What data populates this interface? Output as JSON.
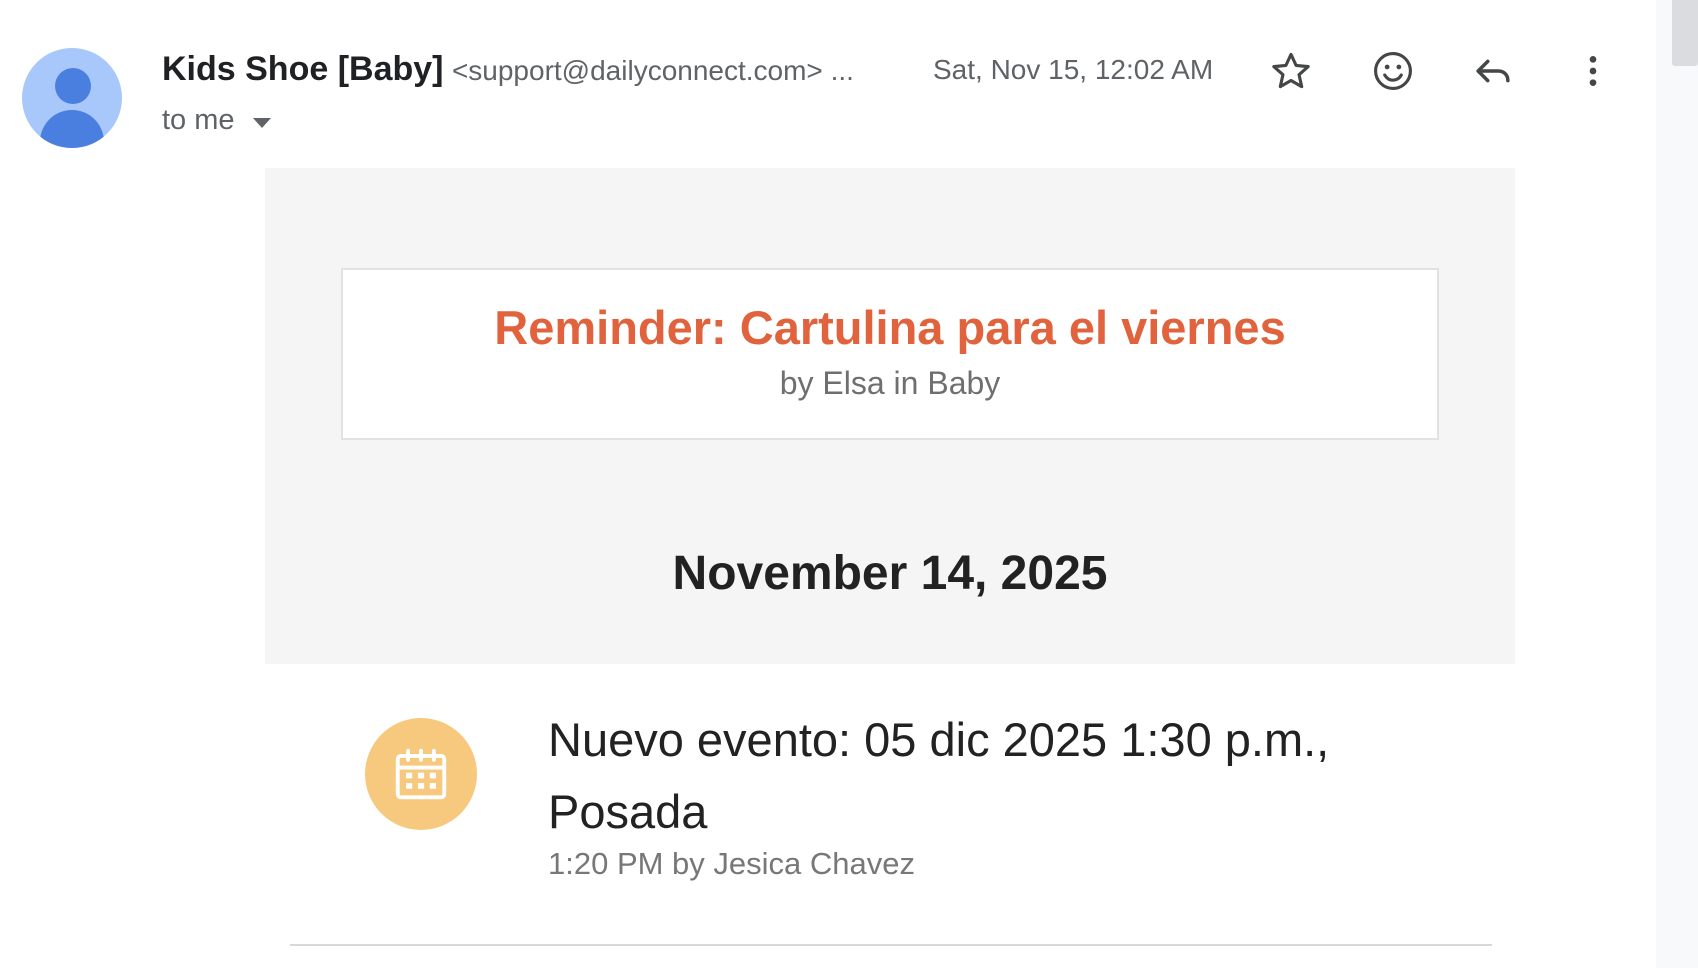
{
  "header": {
    "sender_name": "Kids Shoe [Baby]",
    "sender_email": "<support@dailyconnect.com> ...",
    "recipient_label": "to me",
    "date": "Sat, Nov 15, 12:02 AM",
    "icons": {
      "avatar": "person-avatar-icon",
      "star": "star-icon",
      "emoji": "emoji-reaction-icon",
      "reply": "reply-icon",
      "more": "more-vertical-icon",
      "recipient_caret": "caret-down-icon"
    }
  },
  "message": {
    "title": "Reminder: Cartulina para el viernes",
    "subtitle": "by Elsa in Baby",
    "date_heading": "November 14, 2025",
    "event": {
      "icon": "calendar-icon",
      "title": "Nuevo evento: 05 dic 2025 1:30 p.m., Posada",
      "meta": "1:20 PM by Jesica Chavez"
    }
  },
  "colors": {
    "accent_title": "#e0633d",
    "event_icon_bg": "#f7c97e",
    "avatar_bg": "#a8c7fa",
    "avatar_fg": "#4a7fe0",
    "panel_bg": "#f5f5f5"
  }
}
